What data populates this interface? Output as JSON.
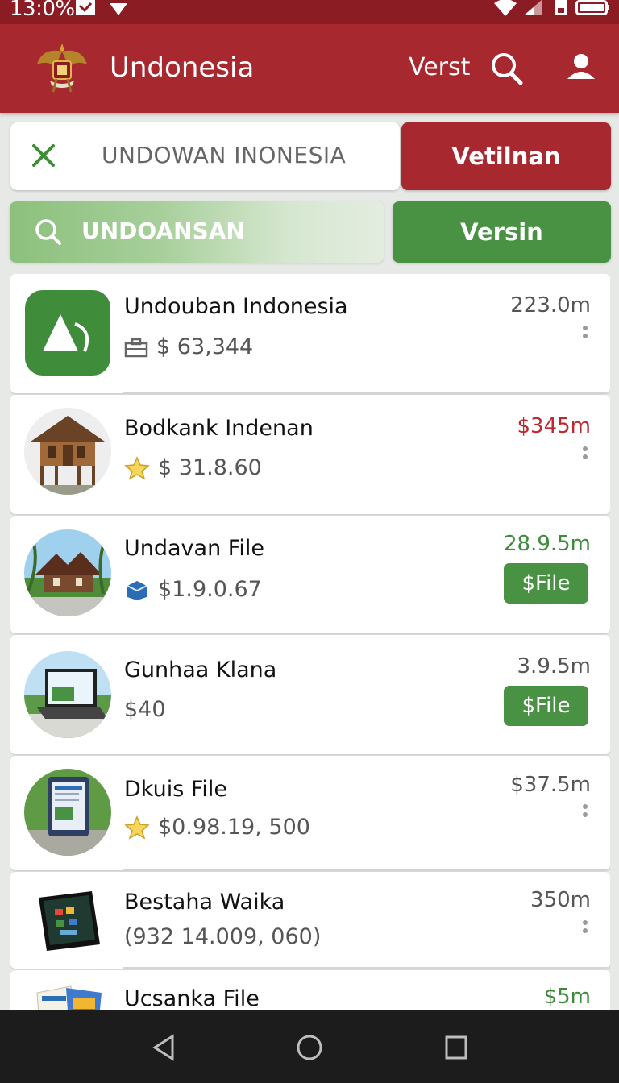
{
  "status_bar": {
    "time": "13:0%"
  },
  "app_bar": {
    "title": "Undonesia",
    "action": "Verst"
  },
  "search": {
    "query": "UNDOWAN INONESIA",
    "button_label": "Vetilnan"
  },
  "filter": {
    "label": "UNDOANSAN",
    "button_label": "Versin"
  },
  "items": [
    {
      "title": "Undouban Indonesia",
      "sub": "$ 63,344",
      "size": "223.0m",
      "size_color": "#555555"
    },
    {
      "title": "Bodkank Indenan",
      "sub": "$ 31.8.60",
      "size": "$345m",
      "size_color": "#c0282f"
    },
    {
      "title": "Undavan File",
      "sub": "$1.9.0.67",
      "size": "28.9.5m",
      "size_color": "#3d8a3a",
      "button": "$File"
    },
    {
      "title": "Gunhaa Klana",
      "sub": "$40",
      "size": "3.9.5m",
      "size_color": "#555555",
      "button": "$File"
    },
    {
      "title": "Dkuis File",
      "sub": "$0.98.19, 500",
      "size": "$37.5m",
      "size_color": "#555555"
    },
    {
      "title": "Bestaha Waika",
      "sub": "(932 14.009, 060)",
      "size": "350m",
      "size_color": "#555555"
    },
    {
      "title": "Ucsanka File",
      "sub": "",
      "size": "$5m",
      "size_color": "#3d8a3a"
    }
  ],
  "colors": {
    "primary": "#a8282f",
    "status_bar": "#8c1c24",
    "accent_green": "#4a9243"
  }
}
